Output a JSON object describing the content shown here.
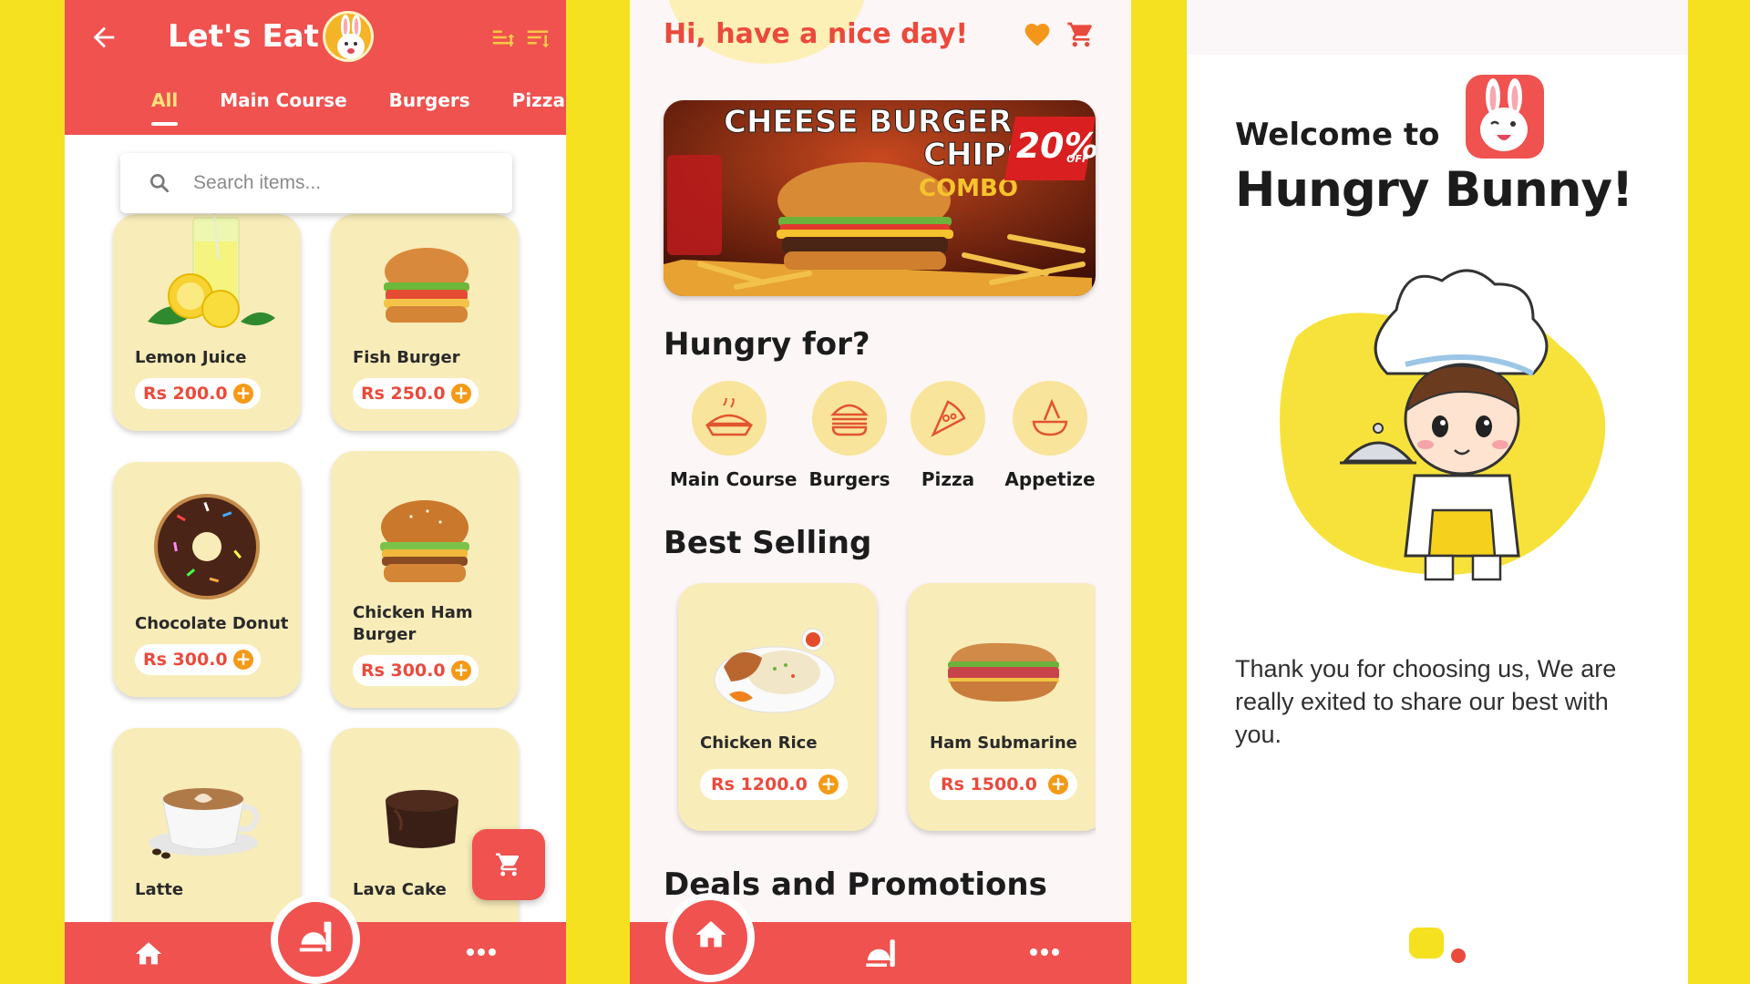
{
  "colors": {
    "background": "#f5e11f",
    "brand_red": "#ef524f",
    "card": "#f8ecb9",
    "accent_orange": "#f49a17",
    "price_red": "#ea4a3c"
  },
  "menu_screen": {
    "title": "Let's Eat",
    "icons": [
      "back-arrow-icon",
      "bunny-logo-icon",
      "sort-ascending-icon",
      "sort-descending-icon"
    ],
    "tabs": [
      {
        "label": "All",
        "active": true
      },
      {
        "label": "Main Course",
        "active": false
      },
      {
        "label": "Burgers",
        "active": false
      },
      {
        "label": "Pizza",
        "active": false
      }
    ],
    "search_placeholder": "Search items...",
    "items": [
      {
        "name": "Lemon Juice",
        "price": "Rs 200.0",
        "image": "lemon-juice"
      },
      {
        "name": "Fish Burger",
        "price": "Rs 250.0",
        "image": "fish-burger"
      },
      {
        "name": "Chocolate Donut",
        "price": "Rs 300.0",
        "image": "chocolate-donut"
      },
      {
        "name": "Chicken Ham Burger",
        "price": "Rs 300.0",
        "image": "chicken-ham-burger"
      },
      {
        "name": "Latte",
        "price": "",
        "image": "latte"
      },
      {
        "name": "Lava Cake",
        "price": "",
        "image": "lava-cake"
      }
    ]
  },
  "home_screen": {
    "greeting": "Hi, have a nice day!",
    "banner": {
      "line1": "CHEESE BURGER",
      "line2": "CHIPS",
      "line3": "COMBO",
      "discount": "20%",
      "discount_suffix": "OFF"
    },
    "hungry_title": "Hungry for?",
    "categories": [
      {
        "label": "Main Course",
        "icon": "rice-dish-icon"
      },
      {
        "label": "Burgers",
        "icon": "burger-icon"
      },
      {
        "label": "Pizza",
        "icon": "pizza-slice-icon"
      },
      {
        "label": "Appetize",
        "icon": "nachos-icon"
      }
    ],
    "best_title": "Best Selling",
    "best_selling": [
      {
        "name": "Chicken Rice",
        "price": "Rs 1200.0"
      },
      {
        "name": "Ham Submarine",
        "price": "Rs 1500.0"
      }
    ],
    "deals_title": "Deals and Promotions"
  },
  "welcome_screen": {
    "welcome": "Welcome to",
    "brand": "Hungry Bunny!",
    "message": "Thank you for choosing us, We are really exited to share our best with you."
  }
}
